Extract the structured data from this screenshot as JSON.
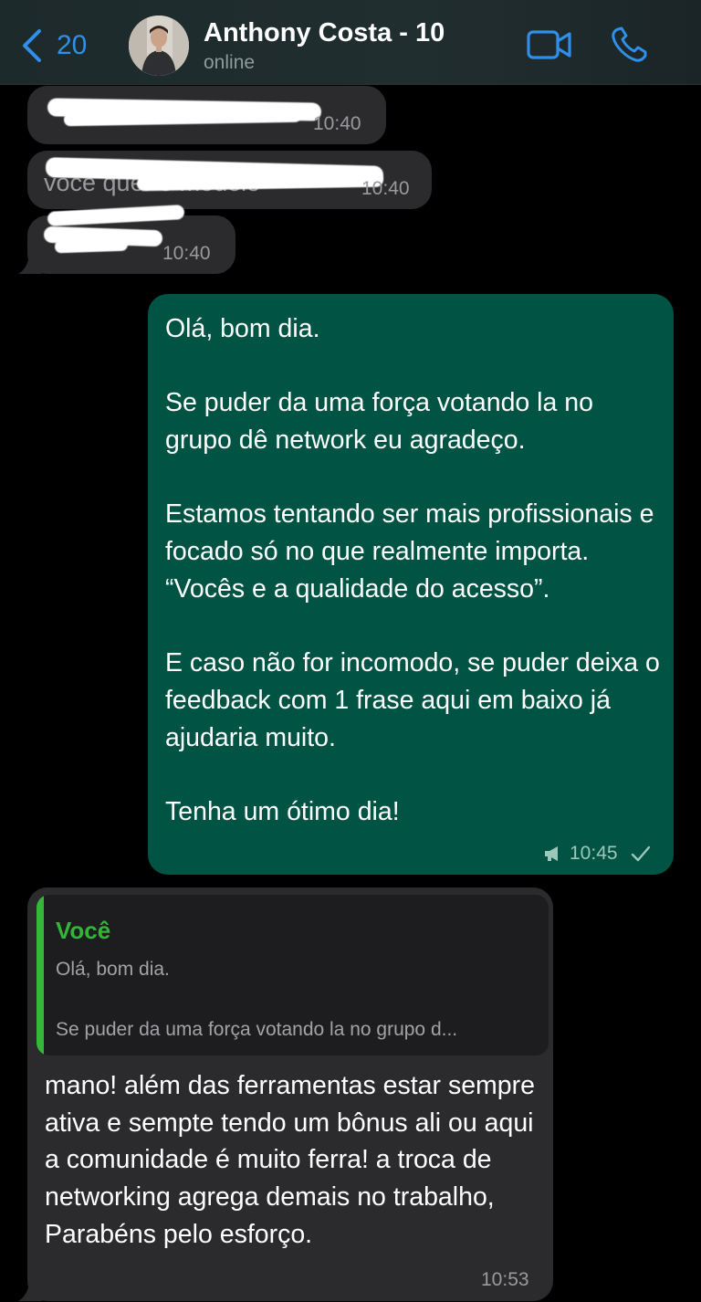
{
  "header": {
    "back_count": "20",
    "contact_name": "Anthony Costa - 10",
    "status": "online"
  },
  "messages": {
    "m1": {
      "time": "10:40"
    },
    "m2": {
      "visible_text": "você quer o modelo",
      "time": "10:40"
    },
    "m3": {
      "time": "10:40"
    },
    "outgoing": {
      "paragraphs": [
        "Olá, bom dia.",
        "Se puder da uma força votando la no grupo dê network eu agradeço.",
        "Estamos tentando ser mais profissionais e focado só no que realmente importa. “Vocês e a qualidade do acesso”.",
        "E caso não for incomodo, se puder deixa o feedback com 1 frase aqui em baixo já ajudaria muito.",
        "Tenha um ótimo dia!"
      ],
      "time": "10:45"
    },
    "reply": {
      "quote_sender": "Você",
      "quote_line1": "Olá, bom dia.",
      "quote_line2": "Se puder da uma força votando la no grupo d...",
      "text": "mano! além das ferramentas estar sempre ativa e sempte tendo um bônus ali ou aqui a comunidade é muito ferra! a troca de networking agrega demais no trabalho, Parabéns pelo esforço.",
      "time": "10:53"
    }
  },
  "colors": {
    "accent_blue": "#2f8fe9",
    "incoming_bubble": "#2b2b2d",
    "outgoing_bubble": "#015443",
    "quote_green": "#34b537"
  }
}
